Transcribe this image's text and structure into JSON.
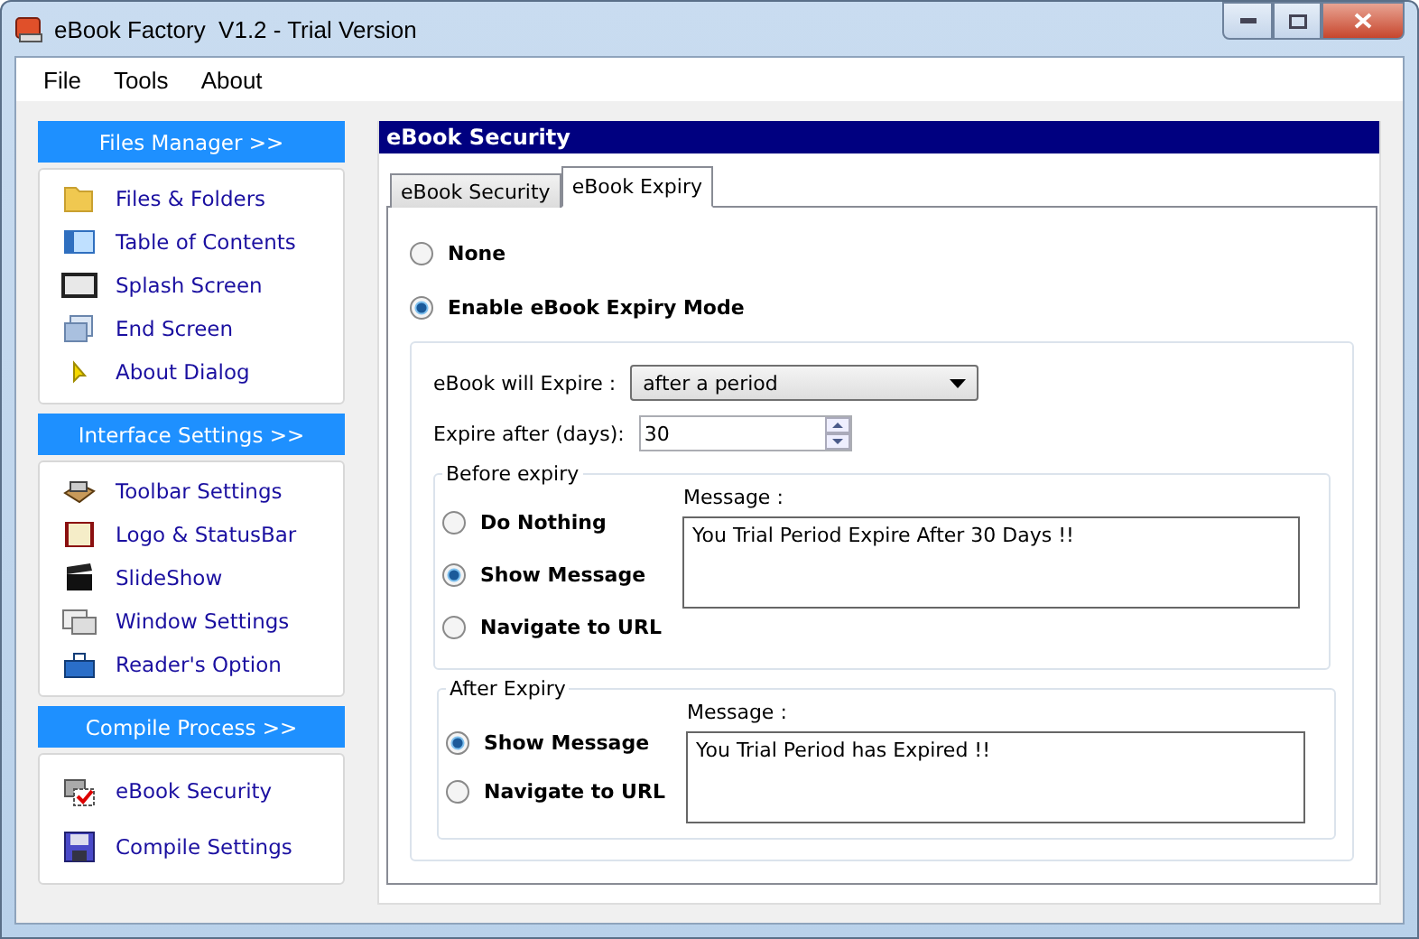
{
  "window": {
    "title": "eBook Factory  V1.2 - Trial Version"
  },
  "menu": [
    "File",
    "Tools",
    "About"
  ],
  "sidebar": {
    "sections": [
      {
        "title": "Files Manager >>",
        "items": [
          {
            "label": "Files & Folders"
          },
          {
            "label": "Table of Contents"
          },
          {
            "label": "Splash Screen"
          },
          {
            "label": "End Screen"
          },
          {
            "label": "About Dialog"
          }
        ]
      },
      {
        "title": "Interface Settings >>",
        "items": [
          {
            "label": "Toolbar Settings"
          },
          {
            "label": "Logo & StatusBar"
          },
          {
            "label": "SlideShow"
          },
          {
            "label": "Window Settings"
          },
          {
            "label": "Reader's Option"
          }
        ]
      },
      {
        "title": "Compile Process >>",
        "items": [
          {
            "label": "eBook Security"
          },
          {
            "label": "Compile Settings"
          }
        ]
      }
    ]
  },
  "panel": {
    "title": "eBook Security",
    "tabs": [
      {
        "label": "eBook Security",
        "selected": false
      },
      {
        "label": "eBook Expiry",
        "selected": true
      }
    ],
    "modes": [
      {
        "label": "None",
        "selected": false
      },
      {
        "label": "Enable eBook Expiry Mode",
        "selected": true
      }
    ],
    "expire_label": "eBook will Expire :",
    "expire_value": "after a period",
    "days_label": "Expire after (days):",
    "days_value": "30",
    "groups": [
      {
        "title": "Before expiry",
        "options": [
          {
            "label": "Do Nothing",
            "selected": false
          },
          {
            "label": "Show Message",
            "selected": true
          },
          {
            "label": "Navigate to URL",
            "selected": false
          }
        ],
        "message_label": "Message :",
        "message": "You Trial Period Expire After 30 Days !!"
      },
      {
        "title": "After Expiry",
        "options": [
          {
            "label": "Show Message",
            "selected": true
          },
          {
            "label": "Navigate to URL",
            "selected": false
          }
        ],
        "message_label": "Message :",
        "message": "You Trial Period has Expired !!"
      }
    ]
  }
}
